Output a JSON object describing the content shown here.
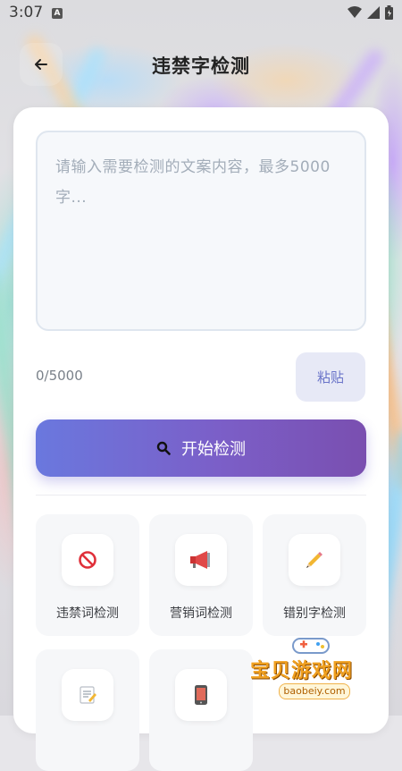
{
  "status": {
    "time": "3:07",
    "notification_icon": "a-icon"
  },
  "header": {
    "title": "违禁字检测",
    "back_icon": "arrow-left-icon"
  },
  "input": {
    "placeholder": "请输入需要检测的文案内容，最多5000字...",
    "value": ""
  },
  "counter": "0/5000",
  "paste_label": "粘贴",
  "start_button": {
    "label": "开始检测",
    "icon": "search-icon"
  },
  "tools": [
    {
      "label": "违禁词检测",
      "icon": "prohibited-icon"
    },
    {
      "label": "营销词检测",
      "icon": "megaphone-icon"
    },
    {
      "label": "错别字检测",
      "icon": "pencil-icon"
    },
    {
      "label": "",
      "icon": "memo-icon"
    },
    {
      "label": "",
      "icon": "phone-icon"
    }
  ],
  "watermark": {
    "text": "宝贝游戏网",
    "url": "baobeiy.com"
  },
  "colors": {
    "accent_start": "#6a78de",
    "accent_end": "#7a4fb0",
    "paste_text": "#6a74c9"
  }
}
